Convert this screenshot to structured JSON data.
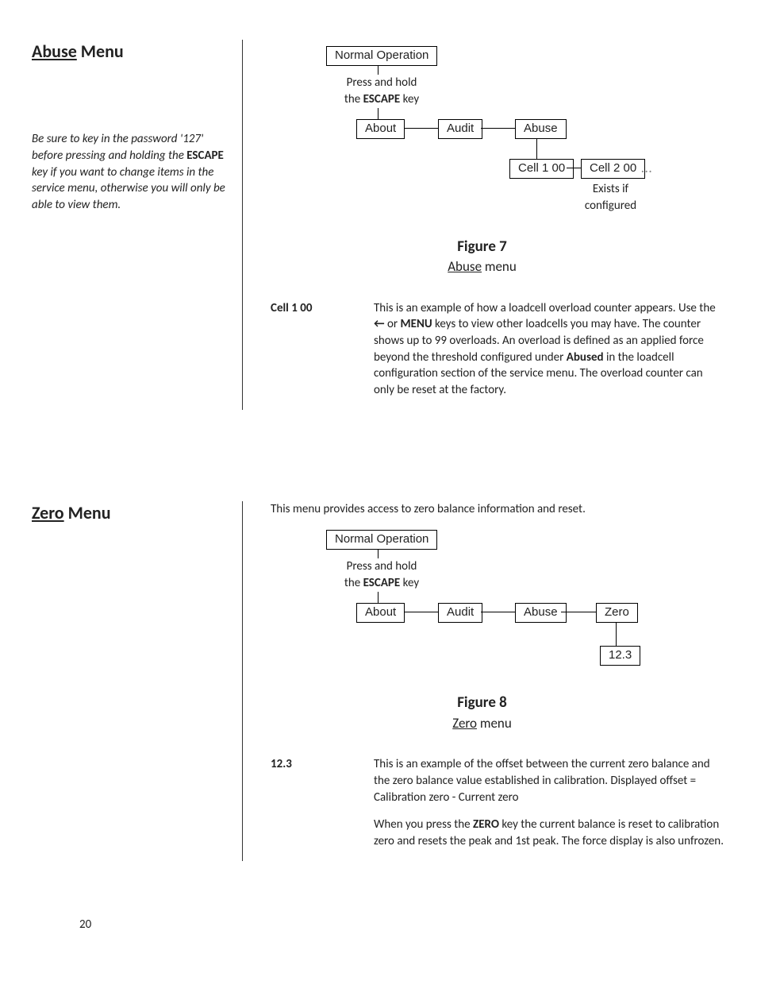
{
  "page_number": "20",
  "section1": {
    "heading_underline": "Abuse",
    "heading_rest": " Menu",
    "sidenote_pre": "Be sure to key in the password '127' before pressing and holding the ",
    "sidenote_b": "ESCAPE",
    "sidenote_post": " key if you want to change items in the service menu, otherwise you will only be able to view them.",
    "fig_num": "Figure 7",
    "fig_title_u": "Abuse",
    "fig_title_rest": " menu",
    "diagram": {
      "normal_op": "Normal Operation",
      "press_hold_l1": "Press and hold",
      "press_hold_l2a": "the ",
      "press_hold_l2b": "ESCAPE",
      "press_hold_l2c": " key",
      "about": "About",
      "audit": "Audit",
      "abuse": "Abuse",
      "cell1": "Cell 1 00",
      "cell2": "Cell 2 00",
      "exists_l1": "Exists if",
      "exists_l2": "configured"
    },
    "def_term": "Cell 1 00",
    "def_body_1": "This is an example of how a loadcell overload counter appears. Use the ",
    "def_body_arrow": "←",
    "def_body_2": " or ",
    "def_body_menu": "MENU",
    "def_body_3": " keys to view other loadcells you may have. The counter shows up to 99 overloads. An overload is defined as an applied force beyond the threshold configured under ",
    "def_body_abused": "Abused",
    "def_body_4": " in the loadcell configuration section of the service menu. The overload counter can only be reset at the factory."
  },
  "section2": {
    "heading_underline": "Zero",
    "heading_rest": " Menu",
    "intro": "This menu provides access to zero balance information and reset.",
    "fig_num": "Figure 8",
    "fig_title_u": "Zero",
    "fig_title_rest": " menu",
    "diagram": {
      "normal_op": "Normal Operation",
      "press_hold_l1": "Press and hold",
      "press_hold_l2a": "the ",
      "press_hold_l2b": "ESCAPE",
      "press_hold_l2c": " key",
      "about": "About",
      "audit": "Audit",
      "abuse": "Abuse",
      "zero": "Zero",
      "value": "12.3"
    },
    "def_term": "12.3",
    "def_p1": "This is an example of the offset between the current zero balance and the zero balance value established in calibration. Displayed offset = Calibration zero - Current zero",
    "def_p2a": "When you press the ",
    "def_p2b": "ZERO",
    "def_p2c": " key the current balance is reset to calibration zero and resets the peak and 1st peak. The force display is also unfrozen."
  }
}
